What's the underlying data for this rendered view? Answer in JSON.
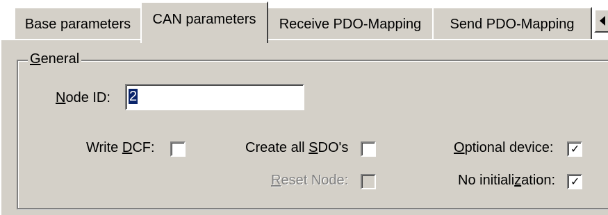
{
  "tabs": [
    {
      "label": "Base parameters",
      "active": false
    },
    {
      "label": "CAN parameters",
      "active": true
    },
    {
      "label": "Receive PDO-Mapping",
      "active": false
    },
    {
      "label": "Send PDO-Mapping",
      "active": false
    }
  ],
  "tab_scroll_icon": "chevron-left-icon",
  "general": {
    "legend_mnemonic": "G",
    "legend_rest": "eneral",
    "node_id": {
      "label_mnemonic": "N",
      "label_rest": "ode ID:",
      "value": "2"
    },
    "write_dcf": {
      "label_pre": "Write ",
      "label_mnemonic": "D",
      "label_post": "CF:",
      "checked": false
    },
    "create_sdos": {
      "label_pre": "Create all ",
      "label_mnemonic": "S",
      "label_post": "DO's",
      "checked": false
    },
    "optional_device": {
      "label_pre": "",
      "label_mnemonic": "O",
      "label_post": "ptional device:",
      "checked": true,
      "mark": "✓"
    },
    "reset_node": {
      "label_pre": "",
      "label_mnemonic": "R",
      "label_post": "eset Node:",
      "checked": false,
      "disabled": true
    },
    "no_initialization": {
      "label_pre": "No initiali",
      "label_mnemonic": "z",
      "label_post": "ation:",
      "checked": true,
      "mark": "✓"
    }
  }
}
